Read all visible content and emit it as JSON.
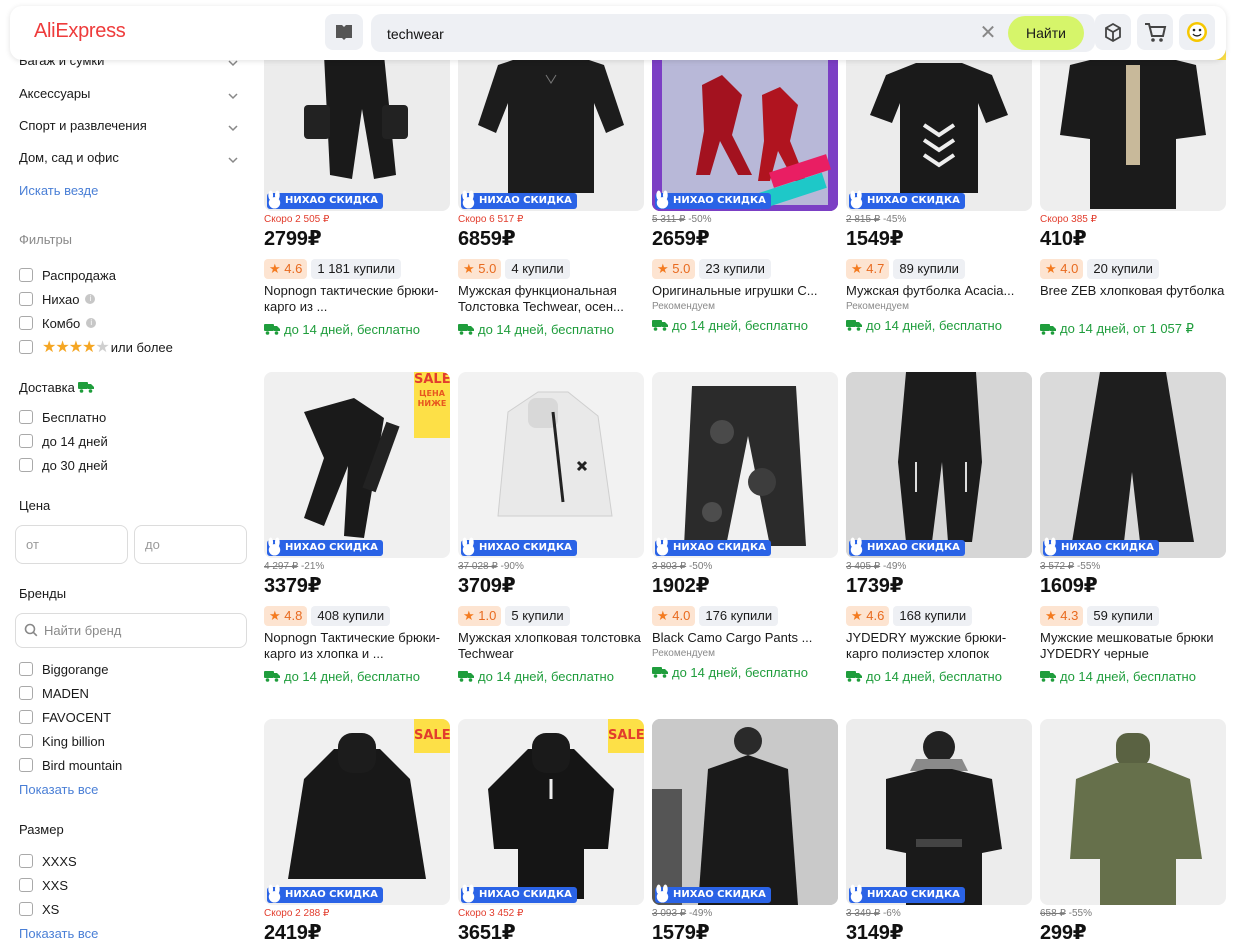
{
  "header": {
    "logo": "AliExpress",
    "search_value": "techwear",
    "search_button": "Найти",
    "icons": [
      "catalog-book-icon",
      "clear-icon",
      "orders-box-icon",
      "cart-icon",
      "profile-smiley-icon"
    ]
  },
  "sidebar": {
    "categories": [
      "Багаж и сумки",
      "Аксессуары",
      "Спорт и развлечения",
      "Дом, сад и офис"
    ],
    "search_everywhere": "Искать везде",
    "filters_title": "Фильтры",
    "filters": [
      "Распродажа",
      "Нихао",
      "Комбо"
    ],
    "rating_suffix": "или более",
    "delivery_title": "Доставка",
    "delivery": [
      "Бесплатно",
      "до 14 дней",
      "до 30 дней"
    ],
    "price_title": "Цена",
    "price_from": "от",
    "price_to": "до",
    "brands_title": "Бренды",
    "brand_search_placeholder": "Найти бренд",
    "brands": [
      "Biggorange",
      "MADEN",
      "FAVOCENT",
      "King billion",
      "Bird mountain"
    ],
    "show_all": "Показать все",
    "size_title": "Размер",
    "sizes": [
      "XXXS",
      "XXS",
      "XS"
    ],
    "show_all_sizes": "Показать все"
  },
  "badge_text": "НИХАО СКИДКА",
  "sale_text": "SALE",
  "sale_sub": "ЦЕНА НИЖЕ",
  "products": [
    {
      "old": "Скоро 2 505 ₽",
      "price": "2799₽",
      "rating": "4.6",
      "sold": "1 181 купили",
      "title": "Nopnogn тактические брюки-карго из ...",
      "ship": "до 14 дней, бесплатно"
    },
    {
      "old": "Скоро 6 517 ₽",
      "price": "6859₽",
      "rating": "5.0",
      "sold": "4 купили",
      "title": "Мужская функциональная Толстовка Techwear, осен...",
      "ship": "до 14 дней, бесплатно"
    },
    {
      "old_strike": "5 311 ₽",
      "discount": "-50%",
      "price": "2659₽",
      "rating": "5.0",
      "sold": "23 купили",
      "title": "Оригинальные игрушки C...",
      "rec": "Рекомендуем",
      "ship": "до 14 дней, бесплатно"
    },
    {
      "old_strike": "2 815 ₽",
      "discount": "-45%",
      "price": "1549₽",
      "rating": "4.7",
      "sold": "89 купили",
      "title": "Мужская футболка Acacia...",
      "rec": "Рекомендуем",
      "ship": "до 14 дней, бесплатно"
    },
    {
      "old": "Скоро 385 ₽",
      "price": "410₽",
      "rating": "4.0",
      "sold": "20 купили",
      "title": "Bree ZEB хлопковая футболка",
      "ship": "до 14 дней, от 1 057 ₽"
    },
    {
      "old_strike": "4 297 ₽",
      "discount": "-21%",
      "price": "3379₽",
      "rating": "4.8",
      "sold": "408 купили",
      "title": "Nopnogn Тактические брюки-карго из хлопка и ...",
      "ship": "до 14 дней, бесплатно"
    },
    {
      "old_strike": "37 028 ₽",
      "discount": "-90%",
      "price": "3709₽",
      "rating": "1.0",
      "sold": "5 купили",
      "title": "Мужская хлопковая толстовка Techwear",
      "ship": "до 14 дней, бесплатно"
    },
    {
      "old_strike": "3 803 ₽",
      "discount": "-50%",
      "price": "1902₽",
      "rating": "4.0",
      "sold": "176 купили",
      "title": "Black Camo Cargo Pants ...",
      "rec": "Рекомендуем",
      "ship": "до 14 дней, бесплатно"
    },
    {
      "old_strike": "3 405 ₽",
      "discount": "-49%",
      "price": "1739₽",
      "rating": "4.6",
      "sold": "168 купили",
      "title": "JYDEDRY мужские брюки-карго полиэстер хлопок",
      "ship": "до 14 дней, бесплатно"
    },
    {
      "old_strike": "3 572 ₽",
      "discount": "-55%",
      "price": "1609₽",
      "rating": "4.3",
      "sold": "59 купили",
      "title": "Мужские мешковатые брюки JYDEDRY черные",
      "ship": "до 14 дней, бесплатно"
    },
    {
      "old": "Скоро 2 288 ₽",
      "price": "2419₽"
    },
    {
      "old": "Скоро 3 452 ₽",
      "price": "3651₽"
    },
    {
      "old_strike": "3 093 ₽",
      "discount": "-49%",
      "price": "1579₽"
    },
    {
      "old_strike": "3 349 ₽",
      "discount": "-6%",
      "price": "3149₽"
    },
    {
      "old_strike": "658 ₽",
      "discount": "-55%",
      "price": "299₽"
    }
  ],
  "colors": {
    "brand": "#ee3b3b",
    "accent": "#d6f56a",
    "badge": "#2a63e6",
    "delivery": "#1f9d3c",
    "link": "#4a7fd6"
  }
}
